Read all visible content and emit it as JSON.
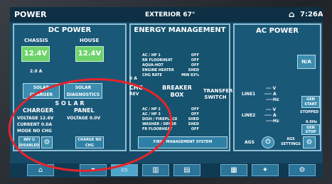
{
  "header": {
    "title": "POWER",
    "exterior": "EXTERIOR  67°",
    "time": "7:26AM"
  },
  "dc": {
    "title": "DC POWER",
    "chassis_label": "CHASSIS",
    "house_label": "HOUSE",
    "chassis_volts": "12.4V",
    "house_volts": "12.4V",
    "amps": "2.0 A",
    "solar_charger": "SOLAR CHARGER",
    "solar_diagnostics": "SOLAR DIAGNOSTICS",
    "solar_title": "S O L A R",
    "charger_head": "CHARGER",
    "panel_head": "PANEL",
    "v_charger": "VOLTAGE  12.6V",
    "v_panel": "VOLTAGE   0.0V",
    "current": "CURRENT  0.0A",
    "mode": "MODE   NO CHG",
    "inv_disabled": "INV ⏻ DISABLED",
    "charge_mode": "CHARGE NO CHG"
  },
  "energy": {
    "title": "ENERGY MANAGEMENT",
    "amp_label": "0 A",
    "lines_top": [
      "AC / HP 1",
      "RR FLOORHEAT",
      "AQUA-HOT",
      "ENGINE HEATER",
      "CHG RATE"
    ],
    "vals_top": [
      "OFF",
      "OFF",
      "OFF",
      "SHED",
      "MIN  83%"
    ],
    "lines_bot": [
      "AC / HP 2",
      "AC / HP 3",
      "DISH / FIREPLACE",
      "WASHER / DRYER",
      "FR FLOORHEAT"
    ],
    "vals_bot": [
      "OFF",
      "OFF",
      "SHED",
      "SHED",
      "OFF"
    ],
    "chg": "CHG",
    "rev": "REV",
    "breaker_box": "BREAKER BOX",
    "first_manager": "FIRST MANAGEMENT SYSTEM",
    "transfer_switch": "TRANSFER SWITCH"
  },
  "ac": {
    "title": "AC POWER",
    "na": "N/A",
    "line1": "LINE1",
    "line2": "LINE2",
    "l1_v": "--- V",
    "l1_a": "---- A",
    "l1_hz": "----Hz",
    "l2_v": "--- V",
    "l2_a": "---- A",
    "l2_hz": "----Hz",
    "gen_start": "GEN START",
    "stopped": "STOPPED",
    "gen_hz": "0.0Hz",
    "gen_stop": "GEN STOP",
    "ags": "AGS",
    "ags_settings": "AGS SETTINGS"
  },
  "nav": {
    "home": "⌂",
    "icons": [
      "⌂",
      "▾",
      "▭",
      "▥",
      "▤",
      "▦",
      "✦",
      "⚙"
    ]
  }
}
